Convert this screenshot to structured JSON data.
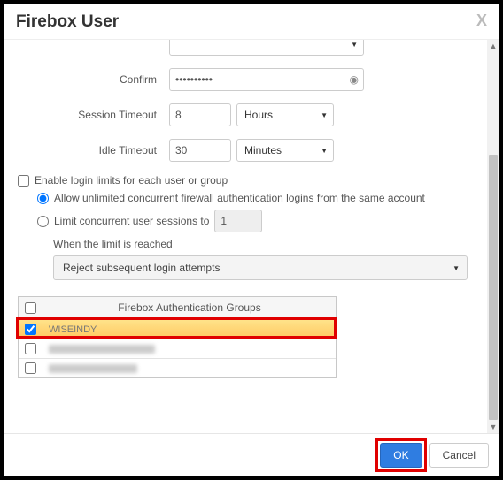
{
  "modal": {
    "title": "Firebox User",
    "close_glyph": "X"
  },
  "form": {
    "confirm_label": "Confirm",
    "confirm_value": "••••••••••",
    "session_timeout_label": "Session Timeout",
    "session_timeout_value": "8",
    "session_timeout_unit": "Hours",
    "idle_timeout_label": "Idle Timeout",
    "idle_timeout_value": "30",
    "idle_timeout_unit": "Minutes"
  },
  "login_limits": {
    "enable_label": "Enable login limits for each user or group",
    "enable_checked": false,
    "allow_unlimited_label": "Allow unlimited concurrent firewall authentication logins from the same account",
    "allow_unlimited_selected": true,
    "limit_concurrent_label": "Limit concurrent user sessions to",
    "limit_concurrent_selected": false,
    "limit_concurrent_value": "1",
    "when_limit_label": "When the limit is reached",
    "limit_action": "Reject subsequent login attempts"
  },
  "groups": {
    "header_label": "Firebox Authentication Groups",
    "rows": [
      {
        "name": "WISEINDY",
        "checked": true
      },
      {
        "name": "",
        "checked": false
      },
      {
        "name": "",
        "checked": false
      }
    ]
  },
  "footer": {
    "ok_label": "OK",
    "cancel_label": "Cancel"
  }
}
